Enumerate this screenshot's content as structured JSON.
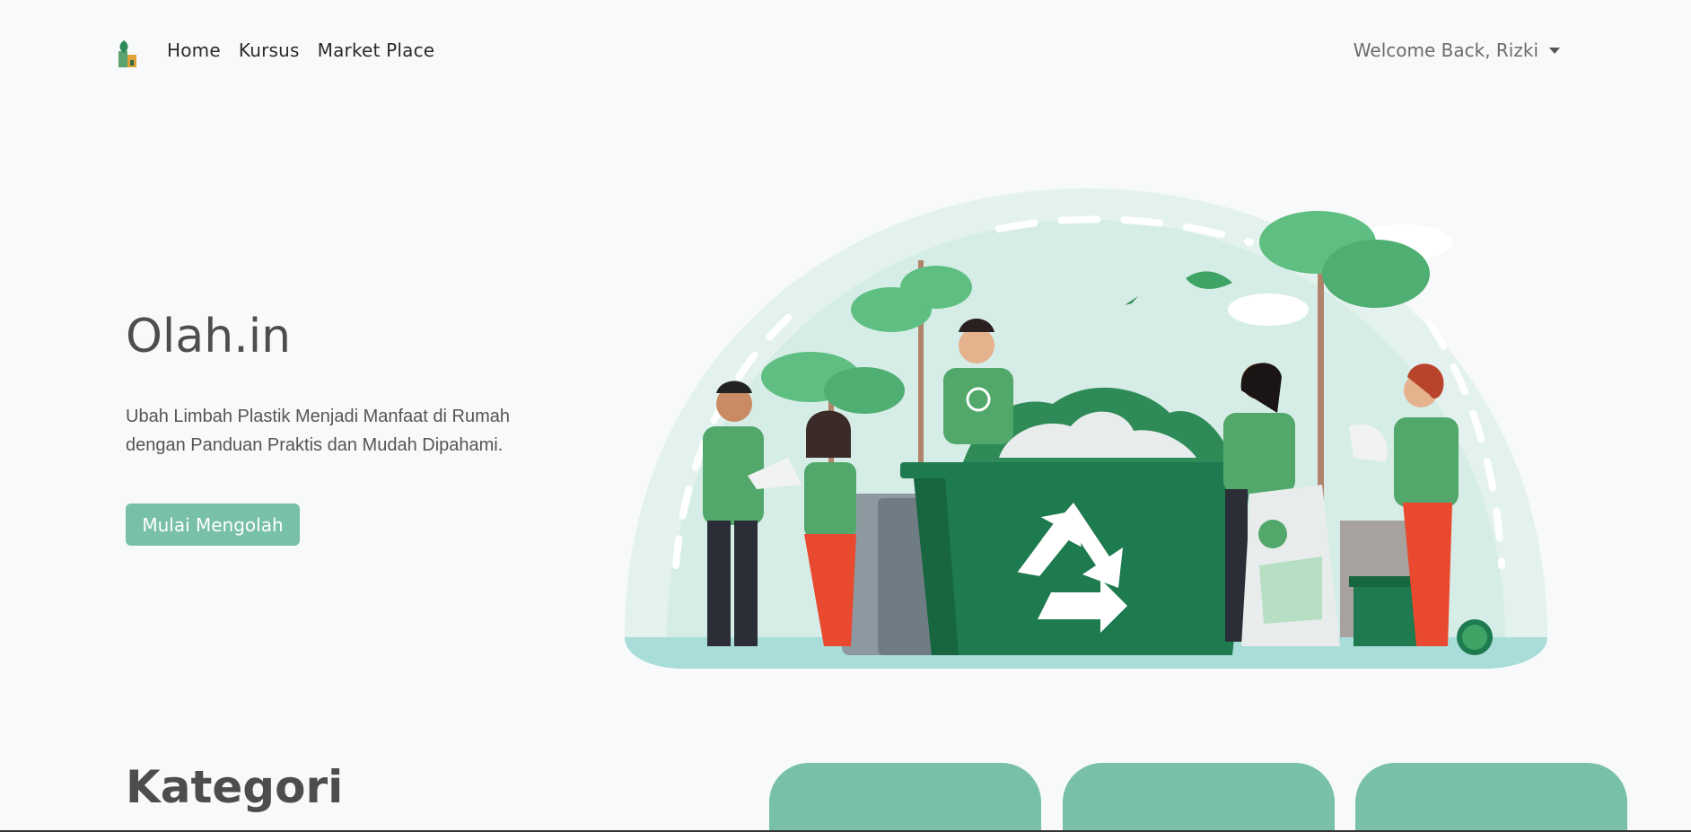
{
  "nav": {
    "logo_icon": "plant-house-logo-icon",
    "links": [
      "Home",
      "Kursus",
      "Market Place"
    ],
    "welcome": "Welcome Back, Rizki",
    "caret_icon": "caret-down-icon"
  },
  "hero": {
    "title": "Olah.in",
    "description": "Ubah Limbah Plastik Menjadi Manfaat di Rumah dengan Panduan Praktis dan Mudah Dipahami.",
    "cta_label": "Mulai Mengolah",
    "illustration": "recycling-people-illustration"
  },
  "kategori": {
    "title": "Kategori"
  },
  "colors": {
    "accent": "#78c0a8",
    "dark_green": "#1e7a4f",
    "background": "#f7f9fa"
  }
}
